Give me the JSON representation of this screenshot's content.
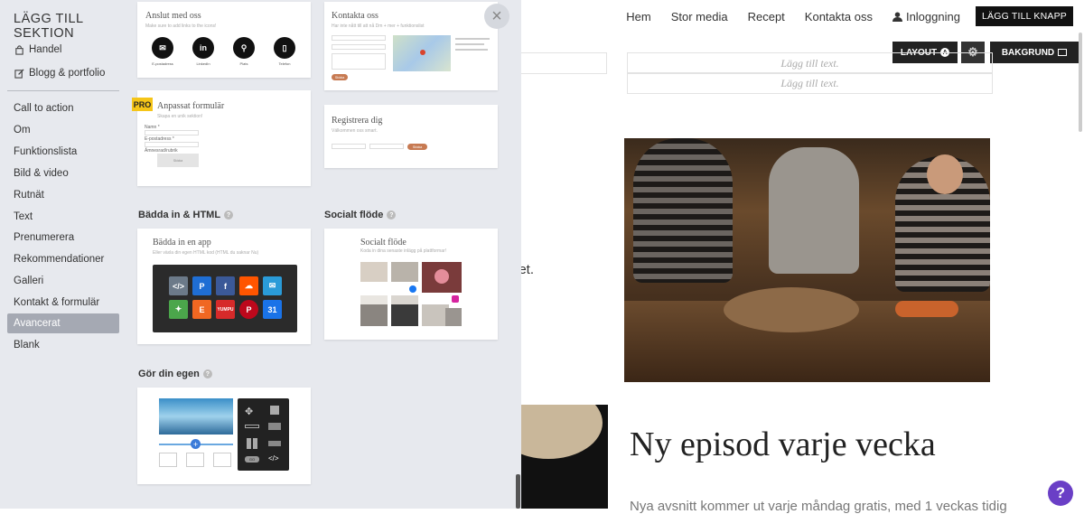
{
  "site": {
    "nav": [
      "Hem",
      "Stor media",
      "Recept",
      "Kontakta oss"
    ],
    "login": "Inloggning",
    "add_button": "LÄGG TILL KNAPP",
    "layout_button": "LAYOUT",
    "layout_badge": "A",
    "background_button": "BAKGRUND",
    "add_text_1": "Lägg till text.",
    "add_text_2": "Lägg till text.",
    "heading": "Ny episod varje vecka",
    "subtext": "Nya avsnitt kommer ut varje måndag gratis, med 1 veckas tidig",
    "fragment": "det.",
    "help": "?"
  },
  "panel": {
    "title": "LÄGG TILL SEKTION",
    "top_items": [
      {
        "label": "Handel",
        "icon": "shopping-bag-icon"
      },
      {
        "label": "Blogg & portfolio",
        "icon": "edit-icon"
      }
    ],
    "items": [
      "Call to action",
      "Om",
      "Funktionslista",
      "Bild & video",
      "Rutnät",
      "Text",
      "Prenumerera",
      "Rekommendationer",
      "Galleri",
      "Kontakt & formulär",
      "Avancerat",
      "Blank"
    ],
    "active_item": "Avancerat",
    "close": "×"
  },
  "cards": {
    "connect": {
      "title": "Anslut med oss",
      "subtitle": "Make sure to add links to the icons!",
      "icons": [
        {
          "glyph": "✉",
          "label": "E-postadress"
        },
        {
          "glyph": "in",
          "label": "LinkedIn"
        },
        {
          "glyph": "⚲",
          "label": "Plats"
        },
        {
          "glyph": "▯",
          "label": "Telefon"
        }
      ]
    },
    "contact": {
      "title": "Kontakta oss",
      "subtitle": "Har inte nått till att nå Dm + mer + funktionslist",
      "button": "Skicka"
    },
    "custom_form": {
      "badge": "PRO",
      "title": "Anpassat formulär",
      "subtitle": "Skapa en unik sektion!",
      "fields": [
        "Namn *",
        "E-postadress *",
        "Ämnesrad/rubrik"
      ],
      "submit": "Skicka"
    },
    "register": {
      "title": "Registrera dig",
      "subtitle": "Välkommen oss smart.",
      "button": "Skicka"
    }
  },
  "sections": {
    "embed": {
      "label": "Bädda in & HTML",
      "card_title": "Bädda in en app",
      "card_subtitle": "Eller växla din egen HTML kod (HTML du saknar Nu)",
      "apps": [
        {
          "glyph": "</>",
          "color": "#6c7a89"
        },
        {
          "glyph": "P",
          "color": "#1f6ed4"
        },
        {
          "glyph": "f",
          "color": "#3b5998"
        },
        {
          "glyph": "☁",
          "color": "#ff5500"
        },
        {
          "glyph": "✉",
          "color": "#2a9bd8"
        },
        {
          "glyph": "✦",
          "color": "#4ba64b"
        },
        {
          "glyph": "E",
          "color": "#f06722"
        },
        {
          "glyph": "YUMPU",
          "color": "#d62a2a"
        },
        {
          "glyph": "P",
          "color": "#bd081c"
        },
        {
          "glyph": "31",
          "color": "#1a73e8"
        }
      ]
    },
    "social": {
      "label": "Socialt flöde",
      "card_title": "Socialt flöde",
      "card_subtitle": "Koda in dina senaste inlägg på plattformar!"
    },
    "custom": {
      "label": "Gör din egen"
    }
  }
}
